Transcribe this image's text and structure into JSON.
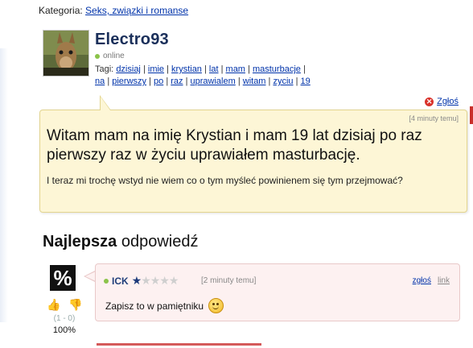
{
  "category": {
    "prefix": "Kategoria:",
    "link": "Seks, związki i romanse"
  },
  "question": {
    "user": "Electro93",
    "status": "online",
    "tags_label": "Tagi:",
    "tags": [
      "dzisiaj",
      "imie",
      "krystian",
      "lat",
      "mam",
      "masturbacje",
      "na",
      "pierwszy",
      "po",
      "raz",
      "uprawialem",
      "witam",
      "zyciu",
      "19"
    ],
    "report": "Zgłoś",
    "time": "[4 minuty temu]",
    "title": "Witam mam na imię Krystian i mam 19 lat dzisiaj po raz pierwszy raz w życiu uprawiałem masturbację.",
    "body": "I teraz mi trochę wstyd nie wiem co o tym myśleć powinienem się tym przejmować?"
  },
  "best_answer": {
    "heading_bold": "Najlepsza",
    "heading_rest": "odpowiedź",
    "avatar_symbol": "%",
    "user": "ICK",
    "rating": 1,
    "rating_max": 5,
    "time": "[2 minuty temu]",
    "report": "zgłoś",
    "link": "link",
    "text": "Zapisz to w pamiętniku",
    "votes": "(1 - 0)",
    "percent": "100%",
    "icons": {
      "thumb_up": "thumb-up-icon",
      "thumb_down": "thumb-down-icon",
      "smiley": "smiley-icon"
    }
  },
  "colors": {
    "link": "#0033aa",
    "username": "#1a2f5a",
    "question_bg": "#fdf6d6",
    "answer_bg": "#fdf1f1",
    "online": "#8bc34a",
    "report_red": "#d9322b"
  }
}
